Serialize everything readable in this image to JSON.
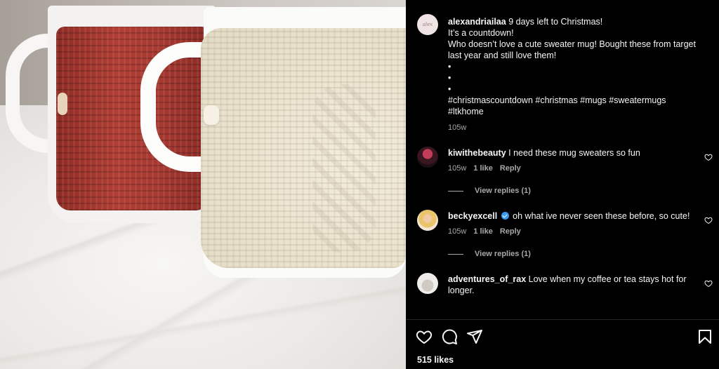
{
  "post": {
    "author": "alexandriailaa",
    "caption_first": "9 days left to Christmas!",
    "caption_lines": [
      "It’s a countdown!",
      "Who doesn’t love a cute sweater mug! Bought these from target last year and still love them!",
      "•",
      "•",
      "•",
      "#christmascountdown #christmas #mugs #sweatermugs",
      "#ltkhome"
    ],
    "time": "105w",
    "likes": "515 likes"
  },
  "comments": [
    {
      "user": "kiwithebeauty",
      "text": "I need these mug sweaters so fun",
      "time": "105w",
      "likes": "1 like",
      "reply": "Reply",
      "view_replies": "View replies (1)",
      "verified": false
    },
    {
      "user": "beckyexcell",
      "text": "oh what ive never seen these before, so cute!",
      "time": "105w",
      "likes": "1 like",
      "reply": "Reply",
      "view_replies": "View replies (1)",
      "verified": true
    },
    {
      "user": "adventures_of_rax",
      "text": "Love when my coffee or tea stays hot for longer.",
      "verified": false
    }
  ],
  "icons": {
    "like": "heart-icon",
    "comment": "comment-icon",
    "share": "send-icon",
    "save": "bookmark-icon",
    "verified": "verified-badge-icon"
  },
  "colors": {
    "background": "#000000",
    "text": "#f5f5f5",
    "muted": "#a8a8a8",
    "verified": "#3897f0"
  }
}
